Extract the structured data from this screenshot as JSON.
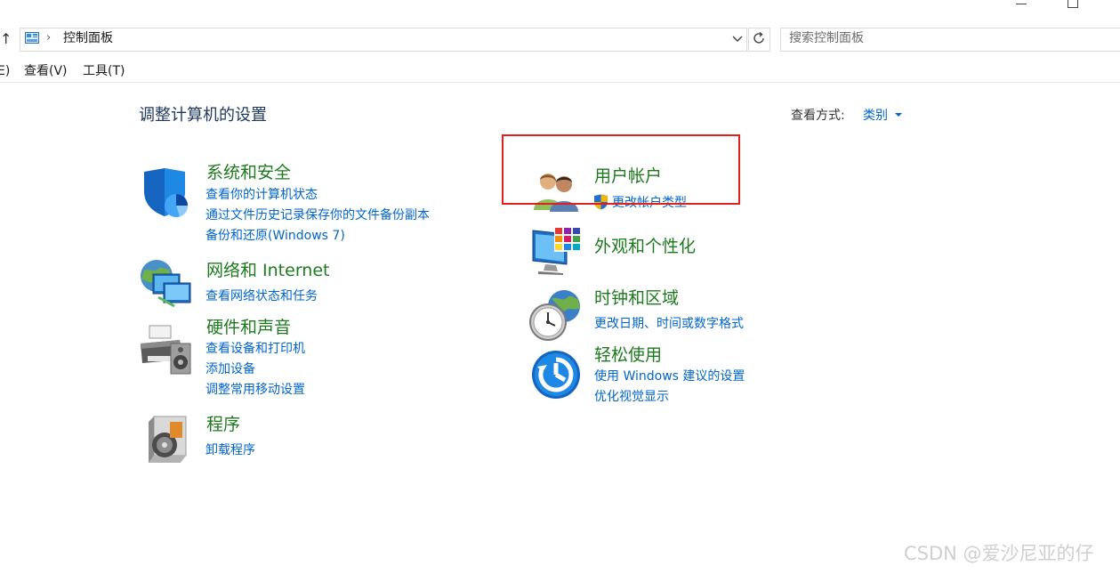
{
  "address_bar": {
    "path_label": "控制面板",
    "search_placeholder": "搜索控制面板"
  },
  "menu": {
    "partial_item": "E)",
    "view": "查看(V)",
    "tools": "工具(T)"
  },
  "main": {
    "title": "调整计算机的设置",
    "view_by_label": "查看方式:",
    "view_by_value": "类别"
  },
  "categories_left": [
    {
      "title": "系统和安全",
      "icon": "shield-icon",
      "links": [
        "查看你的计算机状态",
        "通过文件历史记录保存你的文件备份副本",
        "备份和还原(Windows 7)"
      ]
    },
    {
      "title": "网络和 Internet",
      "icon": "network-globe-icon",
      "links": [
        "查看网络状态和任务"
      ]
    },
    {
      "title": "硬件和声音",
      "icon": "printer-speaker-icon",
      "links": [
        "查看设备和打印机",
        "添加设备",
        "调整常用移动设置"
      ]
    },
    {
      "title": "程序",
      "icon": "programs-disc-icon",
      "links": [
        "卸载程序"
      ]
    }
  ],
  "categories_right": [
    {
      "title": "用户帐户",
      "icon": "users-icon",
      "links": [
        "更改帐户类型"
      ]
    },
    {
      "title": "外观和个性化",
      "icon": "monitor-palette-icon",
      "links": []
    },
    {
      "title": "时钟和区域",
      "icon": "clock-globe-icon",
      "links": [
        "更改日期、时间或数字格式"
      ]
    },
    {
      "title": "轻松使用",
      "icon": "ease-of-access-icon",
      "links": [
        "使用 Windows 建议的设置",
        "优化视觉显示"
      ]
    }
  ],
  "watermark": "CSDN @爱沙尼亚的仔",
  "colors": {
    "category_title": "#1e7a1e",
    "link": "#0066cc",
    "highlight": "#e02020"
  }
}
